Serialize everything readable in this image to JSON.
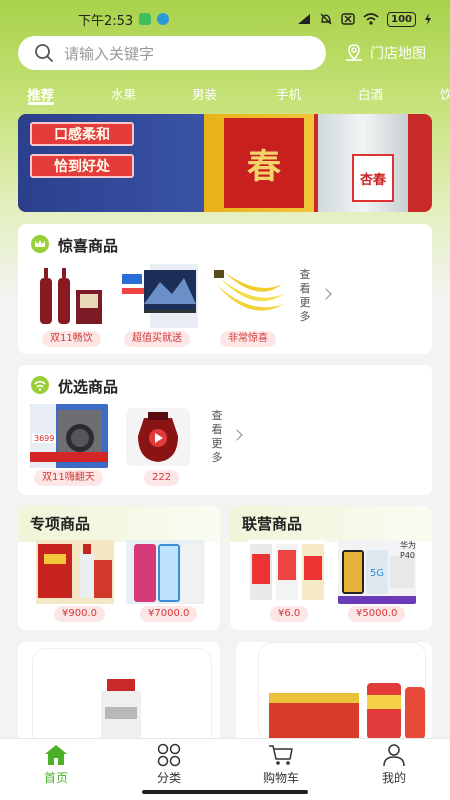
{
  "status": {
    "time": "下午2:53",
    "battery": "100"
  },
  "search": {
    "placeholder": "请输入关键字"
  },
  "store_map": {
    "label": "门店地图"
  },
  "tabs": [
    "推荐",
    "水果",
    "男装",
    "手机",
    "白酒",
    "饮"
  ],
  "banner": {
    "tag1": "口感柔和",
    "tag2": "恰到好处",
    "brand_char": "春",
    "bottle_label": "杏春"
  },
  "surprise": {
    "title": "惊喜商品",
    "items": [
      {
        "tag": "双11畅饮",
        "icon": "wine-bottles-image"
      },
      {
        "tag": "超值买就送",
        "icon": "tv-image"
      },
      {
        "tag": "非常惊喜",
        "icon": "banana-image"
      }
    ],
    "see_more": [
      "查",
      "看",
      "更",
      "多"
    ]
  },
  "featured": {
    "title": "优选商品",
    "items": [
      {
        "tag": "双11嗨翻天",
        "icon": "washing-machine-image",
        "price_badge": "3699"
      },
      {
        "tag": "222",
        "icon": "jar-video-image"
      }
    ],
    "see_more": [
      "查",
      "看",
      "更",
      "多"
    ]
  },
  "special": {
    "title": "专项商品",
    "items": [
      {
        "price": "¥900.0",
        "icon": "liquor-gift-image"
      },
      {
        "price": "¥7000.0",
        "icon": "phone-image"
      }
    ]
  },
  "union": {
    "title": "联营商品",
    "items": [
      {
        "price": "¥6.0",
        "icon": "drink-cans-image"
      },
      {
        "price": "¥5000.0",
        "icon": "huawei-phone-image",
        "label": "华为 P40"
      }
    ]
  },
  "nav": {
    "items": [
      {
        "label": "首页",
        "icon": "home-icon",
        "active": true
      },
      {
        "label": "分类",
        "icon": "category-icon",
        "active": false
      },
      {
        "label": "购物车",
        "icon": "cart-icon",
        "active": false
      },
      {
        "label": "我的",
        "icon": "profile-icon",
        "active": false
      }
    ]
  },
  "colors": {
    "accent": "#4caf28",
    "header_green": "#a8d24a",
    "tag_bg": "#fde6e6",
    "tag_text": "#d23a3a"
  }
}
